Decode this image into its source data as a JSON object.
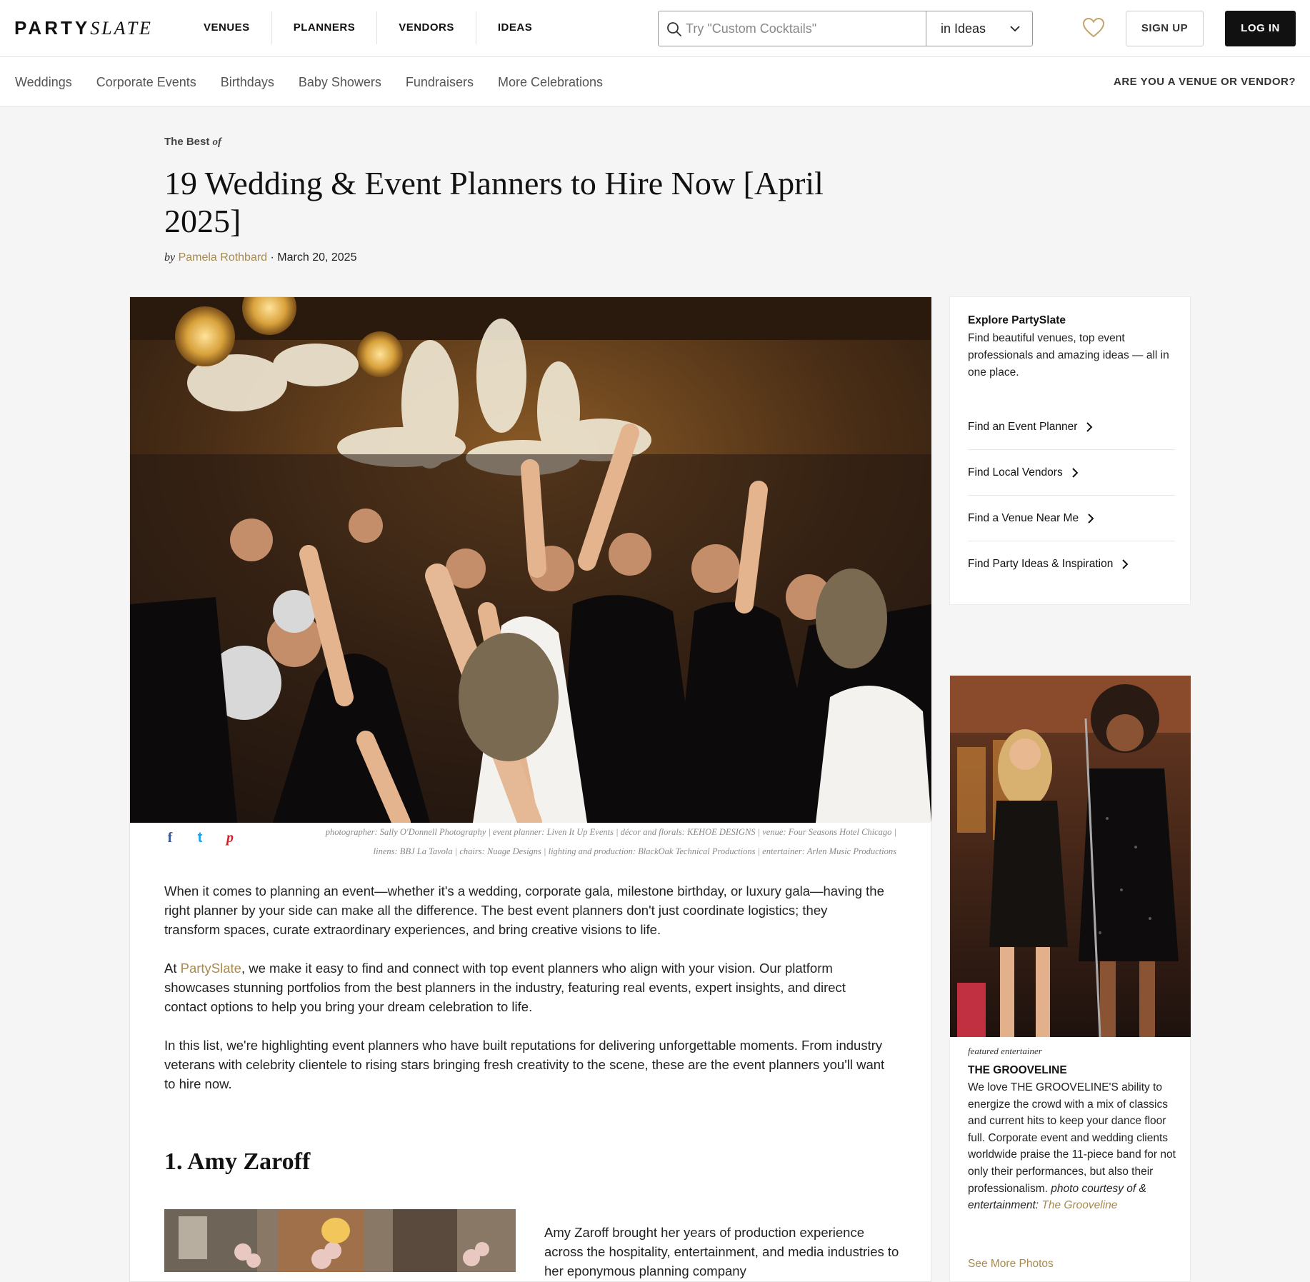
{
  "header": {
    "logo_bold": "PARTY",
    "logo_italic": "SLATE",
    "nav": [
      "VENUES",
      "PLANNERS",
      "VENDORS",
      "IDEAS"
    ],
    "search_placeholder": "Try \"Custom Cocktails\"",
    "search_scope": "in Ideas",
    "signup": "SIGN UP",
    "login": "LOG IN"
  },
  "subnav": {
    "items": [
      "Weddings",
      "Corporate Events",
      "Birthdays",
      "Baby Showers",
      "Fundraisers",
      "More Celebrations"
    ],
    "vendor_cta": "ARE YOU A VENUE OR VENDOR?"
  },
  "article": {
    "eyebrow_pre": "The Best ",
    "eyebrow_of": "of",
    "title": "19 Wedding & Event Planners to Hire Now [April 2025]",
    "by": "by",
    "author": "Pamela Rothbard",
    "sep": " · ",
    "date": "March 20, 2025",
    "share": {
      "facebook": "f",
      "twitter": "t",
      "pinterest": "p"
    },
    "credit_line1": "photographer: Sally O'Donnell Photography | event planner: Liven It Up Events | décor and florals: KEHOE DESIGNS | venue: Four Seasons Hotel Chicago |",
    "credit_line2": "linens: BBJ La Tavola | chairs: Nuage Designs | lighting and production: BlackOak Technical Productions | entertainer: Arlen Music Productions",
    "p1": "When it comes to planning an event—whether it's a wedding, corporate gala, milestone birthday, or luxury gala—having the right planner by your side can make all the difference. The best event planners don't just coordinate logistics; they transform spaces, curate extraordinary experiences, and bring creative visions to life.",
    "p2_pre": "At ",
    "p2_link": "PartySlate",
    "p2_post": ", we make it easy to find and connect with top event planners who align with your vision. Our platform showcases stunning portfolios from the best planners in the industry, featuring real events, expert insights, and direct contact options to help you bring your dream celebration to life.",
    "p3": "In this list, we're highlighting event planners who have built reputations for delivering unforgettable moments. From industry veterans with celebrity clientele to rising stars bringing fresh creativity to the scene, these are the event planners you'll want to hire now.",
    "section1_title": "1. Amy Zaroff",
    "section1_intro": "Amy Zaroff brought her years of production experience across the hospitality, entertainment, and media industries to her eponymous planning company"
  },
  "sidebar": {
    "explore_title": "Explore PartySlate",
    "explore_desc": "Find beautiful venues, top event professionals and amazing ideas — all in one place.",
    "links": [
      "Find an Event Planner",
      "Find Local Vendors",
      "Find a Venue Near Me",
      "Find Party Ideas & Inspiration"
    ],
    "feature_kicker": "featured entertainer",
    "feature_name": "THE GROOVELINE",
    "feature_desc": "We love THE GROOVELINE'S ability to energize the crowd with a mix of classics and current hits to keep your dance floor full. Corporate event and wedding clients worldwide praise the 11-piece band for not only their performances, but also their professionalism. ",
    "feature_credit_pre": "photo courtesy of & entertainment: ",
    "feature_credit_link": "The Grooveline",
    "feature_more": "See More Photos"
  },
  "colors": {
    "accent": "#a88a4e",
    "text": "#111111",
    "background": "#f5f5f5"
  }
}
